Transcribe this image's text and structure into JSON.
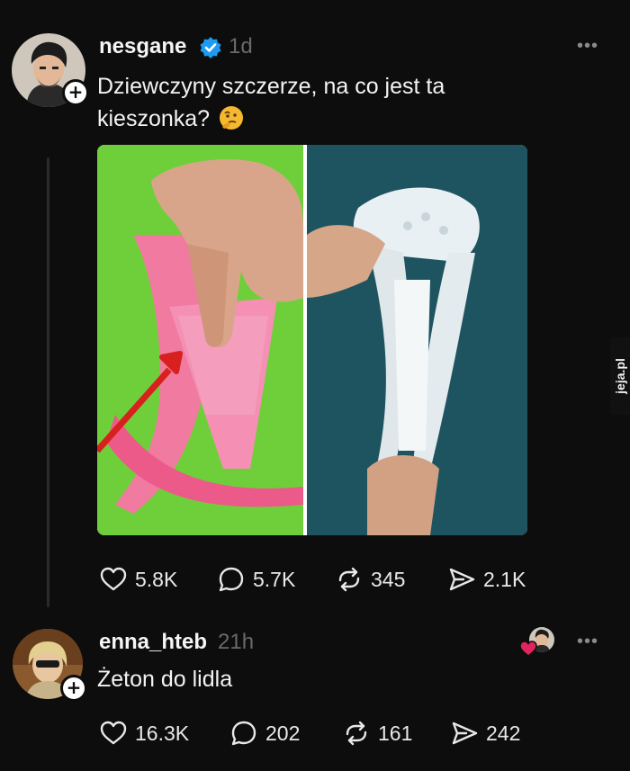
{
  "post": {
    "username": "nesgane",
    "verified": true,
    "time": "1d",
    "more": "•••",
    "text_line1": "Dziewczyny szczerze, na co jest ta",
    "text_line2": "kieszonka?",
    "emoji": "thinking-face-icon",
    "follow": "+",
    "stats": {
      "likes": "5.8K",
      "comments": "5.7K",
      "reposts": "345",
      "shares": "2.1K"
    }
  },
  "reply": {
    "username": "enna_hteb",
    "time": "21h",
    "more": "•••",
    "text": "Żeton do lidla",
    "follow": "+",
    "stats": {
      "likes": "16.3K",
      "comments": "202",
      "reposts": "161",
      "shares": "242"
    }
  },
  "watermark": "jeja.pl",
  "colors": {
    "background": "#0d0d0d",
    "verified_blue": "#1d9bf0",
    "heart_red": "#e0245e",
    "secondary_text": "#6a6a6a"
  }
}
